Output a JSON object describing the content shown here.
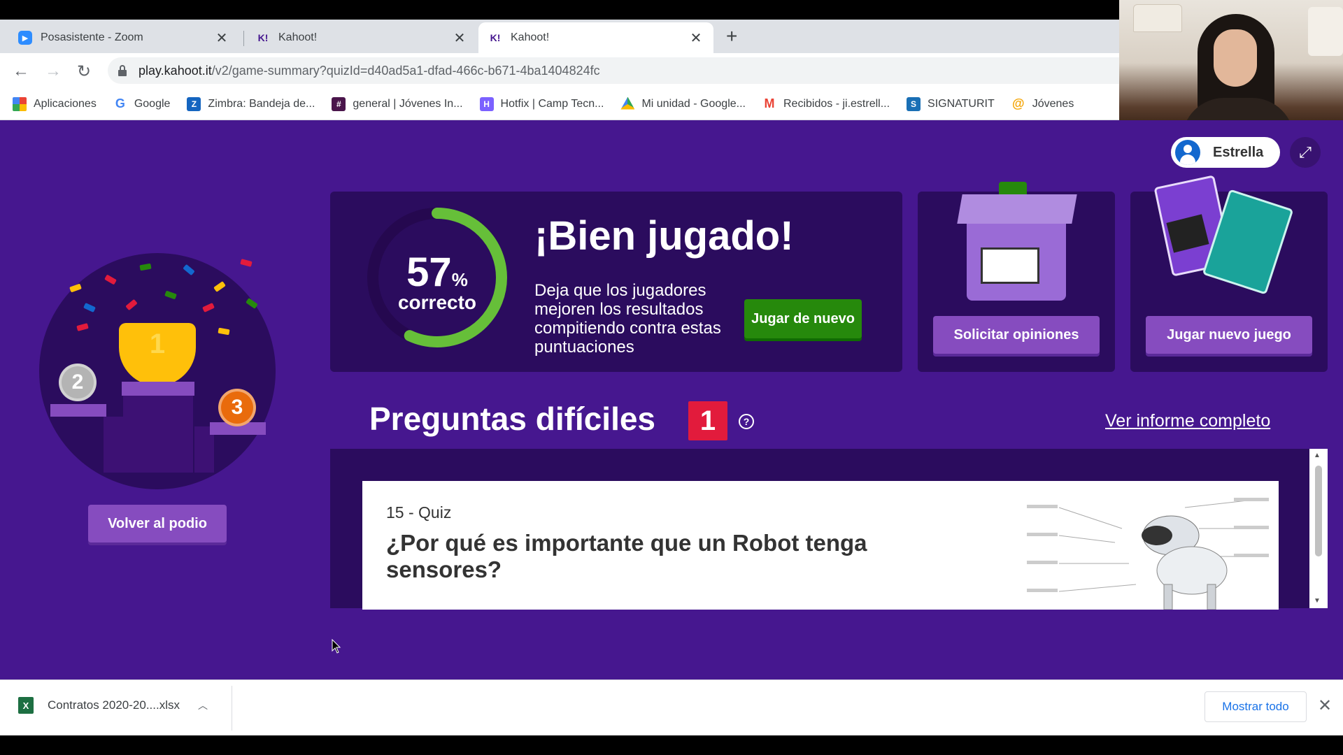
{
  "browser": {
    "tabs": [
      {
        "title": "Posasistente - Zoom",
        "favicon": "zoom-icon",
        "close": "✕"
      },
      {
        "title": "Kahoot!",
        "favicon": "kahoot-icon",
        "close": "✕"
      },
      {
        "title": "Kahoot!",
        "favicon": "kahoot-icon",
        "close": "✕",
        "active": true
      }
    ],
    "new_tab": "+",
    "url_host": "play.kahoot.it",
    "url_path": "/v2/game-summary?quizId=d40ad5a1-dfad-466c-b671-4ba1404824fc",
    "bookmarks": [
      {
        "label": "Aplicaciones",
        "icon": "apps-grid-icon"
      },
      {
        "label": "Google",
        "icon": "google-icon"
      },
      {
        "label": "Zimbra: Bandeja de...",
        "icon": "zimbra-icon"
      },
      {
        "label": "general | Jóvenes In...",
        "icon": "slack-icon"
      },
      {
        "label": "Hotfix | Camp Tecn...",
        "icon": "hotfix-icon"
      },
      {
        "label": "Mi unidad - Google...",
        "icon": "drive-icon"
      },
      {
        "label": "Recibidos - ji.estrell...",
        "icon": "gmail-icon"
      },
      {
        "label": "SIGNATURIT",
        "icon": "signaturit-icon"
      },
      {
        "label": "Jóvenes",
        "icon": "at-icon"
      }
    ]
  },
  "user": {
    "name": "Estrella"
  },
  "podium": {
    "medals": [
      "2",
      "1",
      "3"
    ],
    "back_button": "Volver al podio"
  },
  "summary": {
    "percent": "57",
    "percent_symbol": "%",
    "percent_label": "correcto",
    "percent_value": 0.57,
    "headline": "¡Bien jugado!",
    "subtext": "Deja que los jugadores mejoren los resultados compitiendo contra estas puntuaciones",
    "play_again": "Jugar de nuevo",
    "feedback": "Solicitar opiniones",
    "new_game": "Jugar nuevo juego"
  },
  "hard_questions": {
    "title": "Preguntas difíciles",
    "count": "1",
    "help": "?",
    "report_link": "Ver informe completo",
    "question": {
      "type": "15 - Quiz",
      "text": "¿Por qué es importante que un Robot tenga sensores?"
    }
  },
  "download_bar": {
    "file": "Contratos 2020-20....xlsx",
    "show_all": "Mostrar todo",
    "close": "✕"
  },
  "colors": {
    "background": "#46178f",
    "card": "#2b0c5e",
    "green": "#26890c",
    "red": "#e21b3c",
    "purple_button": "#864cbf"
  }
}
